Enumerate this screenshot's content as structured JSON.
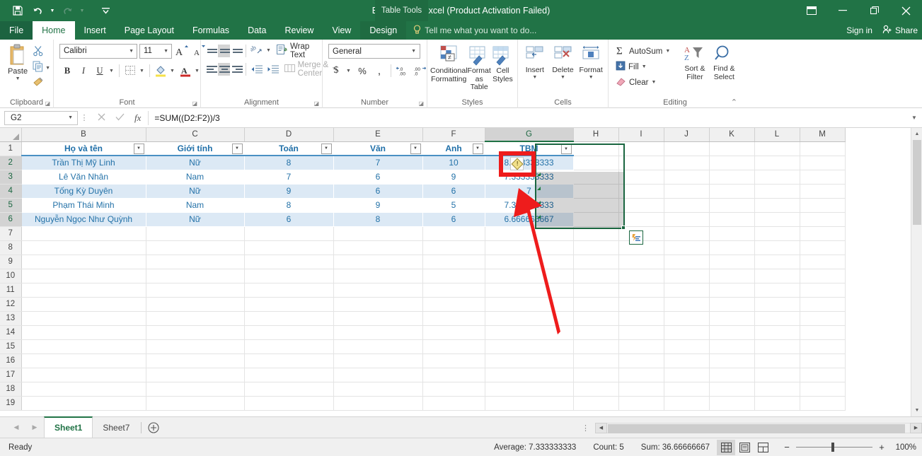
{
  "titlebar": {
    "save_icon": "save-icon",
    "undo_icon": "undo-icon",
    "redo_icon": "redo-icon",
    "customize_icon": "customize-qat-icon",
    "title": "Book1.xlsx - Excel (Product Activation Failed)",
    "contextual_tab_group": "Table Tools",
    "ribbon_display_icon": "ribbon-display-options-icon",
    "minimize_icon": "minimize-icon",
    "restore_icon": "restore-icon",
    "close_icon": "close-icon"
  },
  "ribbon_tabs": {
    "file": "File",
    "items": [
      "Home",
      "Insert",
      "Page Layout",
      "Formulas",
      "Data",
      "Review",
      "View"
    ],
    "design": "Design",
    "tellme": "Tell me what you want to do...",
    "signin": "Sign in",
    "share": "Share"
  },
  "ribbon": {
    "clipboard": {
      "title": "Clipboard",
      "paste": "Paste",
      "cut_icon": "cut-scissors-icon",
      "copy_icon": "copy-icon",
      "format_painter_icon": "format-painter-icon"
    },
    "font": {
      "title": "Font",
      "font_name": "Calibri",
      "font_size": "11",
      "grow_font": "A",
      "shrink_font": "A",
      "bold": "B",
      "italic": "I",
      "underline": "U",
      "borders_icon": "borders-icon",
      "fill_color_icon": "fill-color-icon",
      "font_color_icon": "font-color-icon"
    },
    "alignment": {
      "title": "Alignment",
      "wrap_text": "Wrap Text",
      "merge_center": "Merge & Center",
      "orientation_icon": "text-orientation-icon",
      "decrease_indent_icon": "decrease-indent-icon",
      "increase_indent_icon": "increase-indent-icon"
    },
    "number": {
      "title": "Number",
      "format": "General",
      "currency": "$",
      "percent": "%",
      "comma": ",",
      "increase_decimal_icon": "increase-decimal-icon",
      "decrease_decimal_icon": "decrease-decimal-icon"
    },
    "styles": {
      "title": "Styles",
      "conditional_formatting": "Conditional Formatting",
      "format_as_table": "Format as Table",
      "cell_styles": "Cell Styles"
    },
    "cells": {
      "title": "Cells",
      "insert": "Insert",
      "delete": "Delete",
      "format": "Format"
    },
    "editing": {
      "title": "Editing",
      "autosum": "AutoSum",
      "fill": "Fill",
      "clear": "Clear",
      "sort_filter": "Sort & Filter",
      "find_select": "Find & Select"
    },
    "collapse_icon": "collapse-ribbon-icon"
  },
  "formula_bar": {
    "namebox": "G2",
    "cancel_icon": "cancel-icon",
    "enter_icon": "enter-checkmark-icon",
    "fx_icon": "insert-function-fx-icon",
    "formula": "=SUM((D2:F2))/3",
    "expand_icon": "expand-formula-bar-icon"
  },
  "grid": {
    "column_headers": [
      "B",
      "C",
      "D",
      "E",
      "F",
      "G",
      "H",
      "I",
      "J",
      "K",
      "L",
      "M"
    ],
    "selected_column": "G",
    "row_headers": [
      "1",
      "2",
      "3",
      "4",
      "5",
      "6",
      "7",
      "8",
      "9",
      "10",
      "11",
      "12",
      "13",
      "14",
      "15",
      "16",
      "17",
      "18",
      "19"
    ],
    "table_headers": [
      "Họ và tên",
      "Giới tính",
      "Toán",
      "Văn",
      "Anh",
      "TBM"
    ],
    "rows": [
      {
        "name": "Trần Thị Mỹ Linh",
        "gender": "Nữ",
        "toan": "8",
        "van": "7",
        "anh": "10",
        "tbm": "8.333333333"
      },
      {
        "name": "Lê Văn Nhân",
        "gender": "Nam",
        "toan": "7",
        "van": "6",
        "anh": "9",
        "tbm": "7.333333333"
      },
      {
        "name": "Tống Kỳ Duyên",
        "gender": "Nữ",
        "toan": "9",
        "van": "6",
        "anh": "6",
        "tbm": "7"
      },
      {
        "name": "Phạm Thái Minh",
        "gender": "Nam",
        "toan": "8",
        "van": "9",
        "anh": "5",
        "tbm": "7.333333333"
      },
      {
        "name": "Nguyễn Ngọc Như Quỳnh",
        "gender": "Nữ",
        "toan": "6",
        "van": "8",
        "anh": "6",
        "tbm": "6.666666667"
      }
    ],
    "filter_icon": "filter-dropdown-icon",
    "warning_icon": "error-warning-diamond-icon",
    "quick_analysis_icon": "quick-analysis-icon",
    "annotation_highlight": "red-rectangle-annotation",
    "annotation_arrow": "red-arrow-annotation"
  },
  "sheet_tabs": {
    "prev_icon": "previous-sheet-icon",
    "next_icon": "next-sheet-icon",
    "tabs": [
      "Sheet1",
      "Sheet7"
    ],
    "active": "Sheet1",
    "add_icon": "add-sheet-icon"
  },
  "statusbar": {
    "status": "Ready",
    "average": "Average: 7.333333333",
    "count": "Count: 5",
    "sum": "Sum: 36.66666667",
    "normal_view_icon": "normal-view-icon",
    "page_layout_icon": "page-layout-view-icon",
    "page_break_icon": "page-break-preview-icon",
    "zoom_out": "−",
    "zoom_in": "+",
    "zoom_level": "100%"
  },
  "colors": {
    "excel_green": "#217346",
    "table_blue_text": "#2472a8",
    "band_blue": "#dce9f5",
    "annotation_red": "#ee1c1c",
    "selection_green": "#1a6640"
  }
}
